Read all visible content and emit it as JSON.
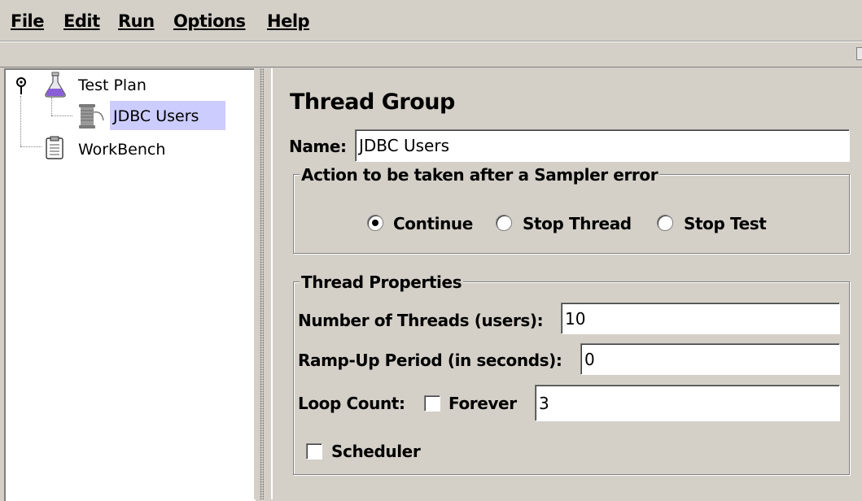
{
  "menu": [
    "File",
    "Edit",
    "Run",
    "Options",
    "Help"
  ],
  "tree": {
    "root": "Test Plan",
    "child": "JDBC Users",
    "workbench": "WorkBench"
  },
  "panel": {
    "title": "Thread Group",
    "name_label": "Name:",
    "name_value": "JDBC Users",
    "error_group": {
      "title": "Action to be taken after a Sampler error",
      "options": [
        "Continue",
        "Stop Thread",
        "Stop Test"
      ],
      "selected": "Continue"
    },
    "props": {
      "title": "Thread Properties",
      "threads_label": "Number of Threads (users):",
      "threads_value": "10",
      "rampup_label": "Ramp-Up Period (in seconds):",
      "rampup_value": "0",
      "loop_label": "Loop Count:",
      "forever_label": "Forever",
      "forever_checked": false,
      "loop_value": "3",
      "scheduler_label": "Scheduler",
      "scheduler_checked": false
    }
  },
  "colors": {
    "background": "#d4d0c8",
    "selection": "#ccccff"
  }
}
